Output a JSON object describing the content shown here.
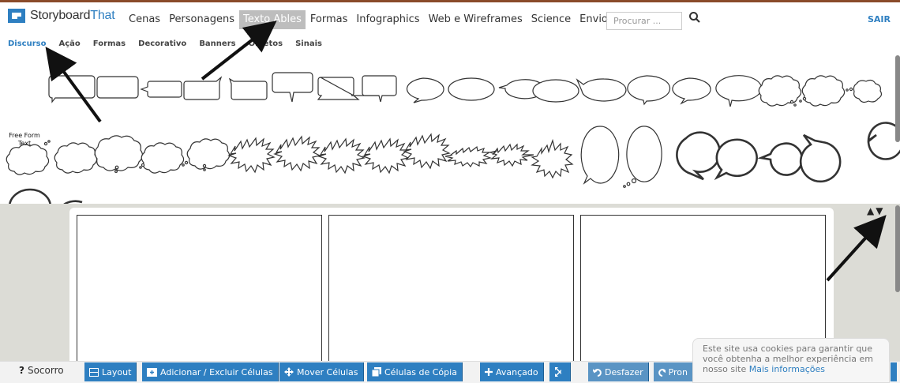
{
  "app": {
    "logo_storyboard": "Storyboard",
    "logo_that": "That"
  },
  "nav": {
    "items": [
      "Cenas",
      "Personagens",
      "Texto Ables",
      "Formas",
      "Infographics",
      "Web e Wireframes",
      "Science",
      "Envio"
    ],
    "active_index": 2
  },
  "search": {
    "placeholder": "Procurar ..."
  },
  "sair": "SAIR",
  "subtabs": {
    "items": [
      "Discurso",
      "Ação",
      "Formas",
      "Decorativo",
      "Banners",
      "Objetos",
      "Sinais"
    ],
    "active_index": 0
  },
  "palette": {
    "free_form_text": "Free Form Text"
  },
  "reorder_arrows": "▲▼",
  "toolbar": {
    "help_icon": "?",
    "help_label": "Socorro",
    "layout": "Layout",
    "add_remove_cells": "Adicionar / Excluir Células",
    "move_cells": "Mover Células",
    "copy_cells": "Células de Cópia",
    "advanced": "Avançado",
    "undo": "Desfazer",
    "redo_partial": "Pron"
  },
  "cookie": {
    "text": "Este site usa cookies para garantir que você obtenha a melhor experiência em nosso site",
    "link": "Mais informações"
  },
  "colors": {
    "brand_blue": "#2e7fc1",
    "nav_active": "#bdbdbd",
    "board_bg": "#dcdcd6"
  }
}
